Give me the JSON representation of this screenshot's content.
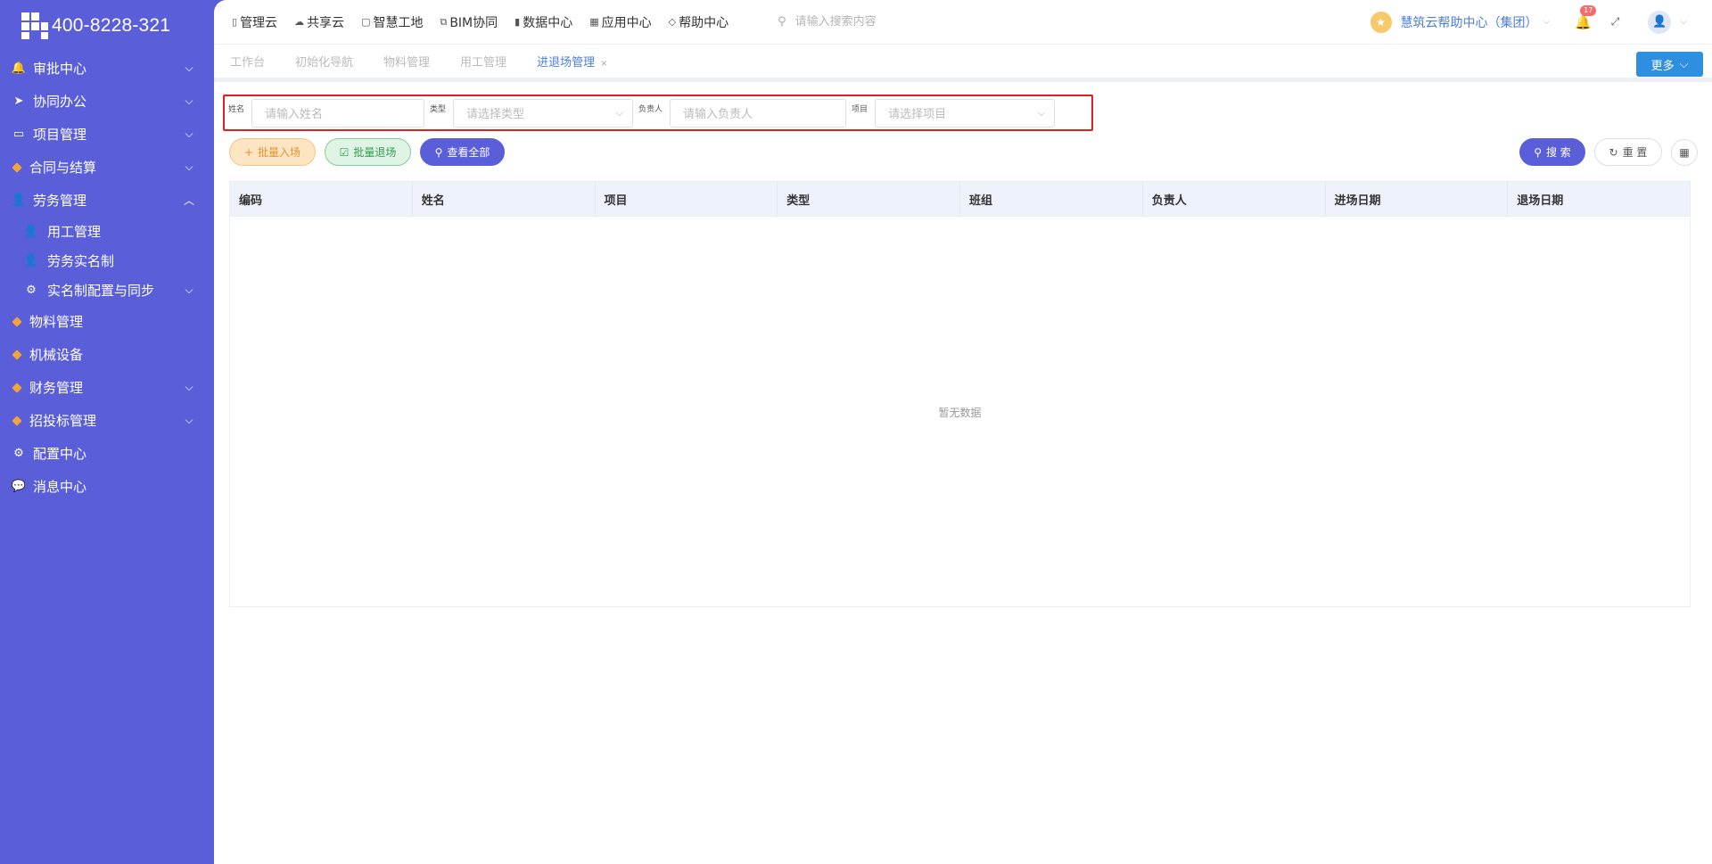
{
  "brand": {
    "phone": "400-8228-321"
  },
  "sidebar": {
    "items": [
      {
        "label": "审批中心",
        "icon": "🔔",
        "expandable": true,
        "chev": "⌵"
      },
      {
        "label": "协同办公",
        "icon": "➤",
        "expandable": true,
        "chev": "⌵"
      },
      {
        "label": "项目管理",
        "icon": "▭",
        "expandable": true,
        "chev": "⌵"
      },
      {
        "label": "合同与结算",
        "icon": "gem",
        "expandable": true,
        "chev": "⌵"
      },
      {
        "label": "劳务管理",
        "icon": "👤",
        "expandable": true,
        "chev": "︿"
      },
      {
        "label": "用工管理",
        "icon": "👤",
        "sub": true
      },
      {
        "label": "劳务实名制",
        "icon": "👤",
        "sub": true
      },
      {
        "label": "实名制配置与同步",
        "icon": "⚙",
        "sub": true,
        "expandable": true,
        "chev": "⌵"
      },
      {
        "label": "物料管理",
        "icon": "gem"
      },
      {
        "label": "机械设备",
        "icon": "gem"
      },
      {
        "label": "财务管理",
        "icon": "gem",
        "expandable": true,
        "chev": "⌵"
      },
      {
        "label": "招投标管理",
        "icon": "gem",
        "expandable": true,
        "chev": "⌵"
      },
      {
        "label": "配置中心",
        "icon": "⚙"
      },
      {
        "label": "消息中心",
        "icon": "💬"
      }
    ]
  },
  "topnav": {
    "items": [
      {
        "label": "管理云",
        "icon": "▯"
      },
      {
        "label": "共享云",
        "icon": "☁"
      },
      {
        "label": "智慧工地",
        "icon": "▢"
      },
      {
        "label": "BIM协同",
        "icon": "⧉"
      },
      {
        "label": "数据中心",
        "icon": "▮"
      },
      {
        "label": "应用中心",
        "icon": "▦"
      },
      {
        "label": "帮助中心",
        "icon": "◇"
      }
    ],
    "search_placeholder": "请输入搜索内容",
    "org_name": "慧筑云帮助中心（集团）",
    "notification_count": "17"
  },
  "tabs": {
    "items": [
      {
        "label": "工作台"
      },
      {
        "label": "初始化导航"
      },
      {
        "label": "物料管理"
      },
      {
        "label": "用工管理"
      },
      {
        "label": "进退场管理",
        "active": true
      }
    ],
    "close_glyph": "×",
    "more_label": "更多"
  },
  "filter": {
    "name_label": "姓名",
    "name_placeholder": "请输入姓名",
    "type_label": "类型",
    "type_placeholder": "请选择类型",
    "owner_label": "负责人",
    "owner_placeholder": "请输入负责人",
    "project_label": "项目",
    "project_placeholder": "请选择项目"
  },
  "actions": {
    "batch_entry": "批量入场",
    "batch_exit": "批量退场",
    "view_all": "查看全部",
    "search": "搜 索",
    "reset": "重 置"
  },
  "table": {
    "columns": [
      "编码",
      "姓名",
      "项目",
      "类型",
      "班组",
      "负责人",
      "进场日期",
      "退场日期"
    ],
    "empty_text": "暂无数据"
  },
  "colors": {
    "sidebar_bg": "#5a5fd9",
    "accent_blue": "#4a7fe0",
    "highlight_border": "#e02020"
  }
}
